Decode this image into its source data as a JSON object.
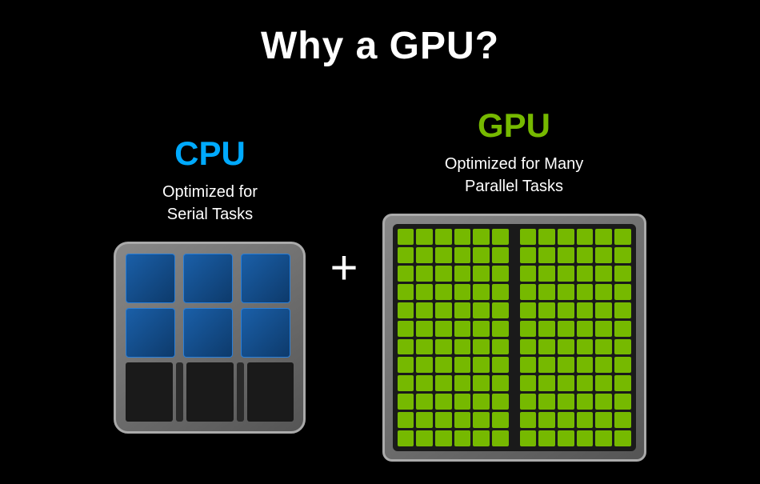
{
  "title": "Why a GPU?",
  "cpu": {
    "label": "CPU",
    "description_line1": "Optimized for",
    "description_line2": "Serial Tasks"
  },
  "gpu": {
    "label": "GPU",
    "description_line1": "Optimized for Many",
    "description_line2": "Parallel Tasks"
  },
  "plus": "+"
}
